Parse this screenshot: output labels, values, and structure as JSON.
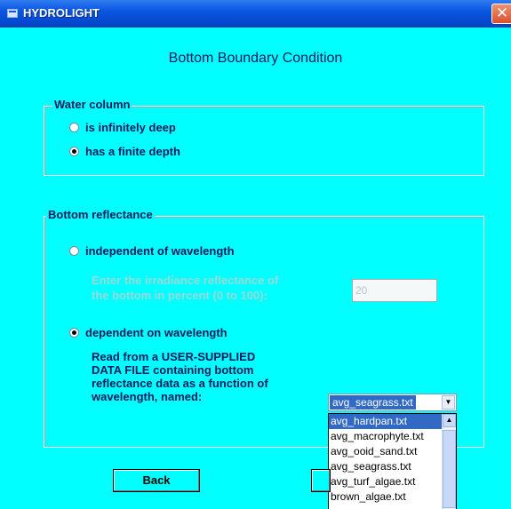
{
  "window": {
    "title": "HYDROLIGHT",
    "close_label": "✕"
  },
  "heading": "Bottom Boundary Condition",
  "water_column": {
    "legend": "Water column",
    "options": [
      {
        "label": "is infinitely deep",
        "selected": false
      },
      {
        "label": "has a finite depth",
        "selected": true
      }
    ]
  },
  "bottom_reflectance": {
    "legend": "Bottom reflectance",
    "independent": {
      "label": "independent of wavelength",
      "selected": false,
      "prompt_line1": "Enter the irradiance reflectance of",
      "prompt_line2": "the bottom in percent (0 to 100):",
      "value": "20"
    },
    "dependent": {
      "label": "dependent on wavelength",
      "selected": true,
      "note_lines": [
        "Read from a USER-SUPPLIED",
        "DATA FILE containing bottom",
        "reflectance data as a function of",
        "wavelength, named:"
      ]
    },
    "file_select": {
      "selected": "avg_seagrass.txt",
      "options": [
        "avg_hardpan.txt",
        "avg_macrophyte.txt",
        "avg_ooid_sand.txt",
        "avg_seagrass.txt",
        "avg_turf_algae.txt",
        "brown_algae.txt"
      ],
      "highlighted": "avg_hardpan.txt"
    }
  },
  "buttons": {
    "back": "Back"
  }
}
